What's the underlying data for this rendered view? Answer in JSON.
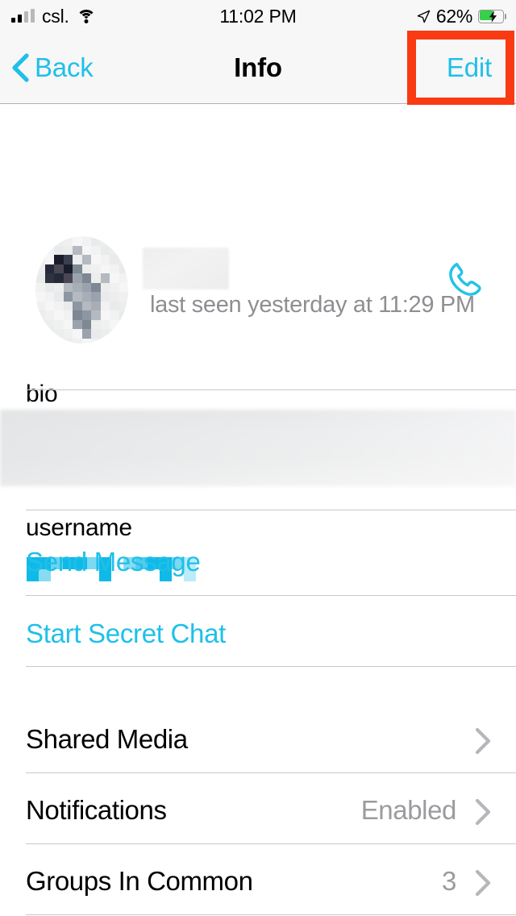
{
  "status_bar": {
    "carrier": "csl.",
    "time": "11:02 PM",
    "battery_percent": "62%",
    "battery_level": 62,
    "charging": true,
    "signal_bars": 2,
    "wifi": true,
    "location_arrow": true
  },
  "nav_bar": {
    "back_label": "Back",
    "title": "Info",
    "edit_label": "Edit",
    "highlight_color": "#f93a12",
    "tint_color": "#1fc0e8"
  },
  "profile": {
    "avatar_state": "pixelated-redacted",
    "name": "",
    "name_state": "blurred-redacted",
    "last_seen": "last seen yesterday at 11:29 PM",
    "call_icon": "phone-icon"
  },
  "bio_section": {
    "label": "bio",
    "value": "",
    "value_state": "blurred-redacted"
  },
  "username_section": {
    "label": "username",
    "value": "",
    "value_state": "pixelated-redacted",
    "value_color": "#0fb9e8"
  },
  "actions": [
    {
      "label": "Send Message",
      "name": "send-message-button"
    },
    {
      "label": "Start Secret Chat",
      "name": "start-secret-chat-button"
    }
  ],
  "settings_rows": [
    {
      "label": "Shared Media",
      "value": "",
      "chevron": true
    },
    {
      "label": "Notifications",
      "value": "Enabled",
      "chevron": true
    },
    {
      "label": "Groups In Common",
      "value": "3",
      "chevron": true
    }
  ]
}
